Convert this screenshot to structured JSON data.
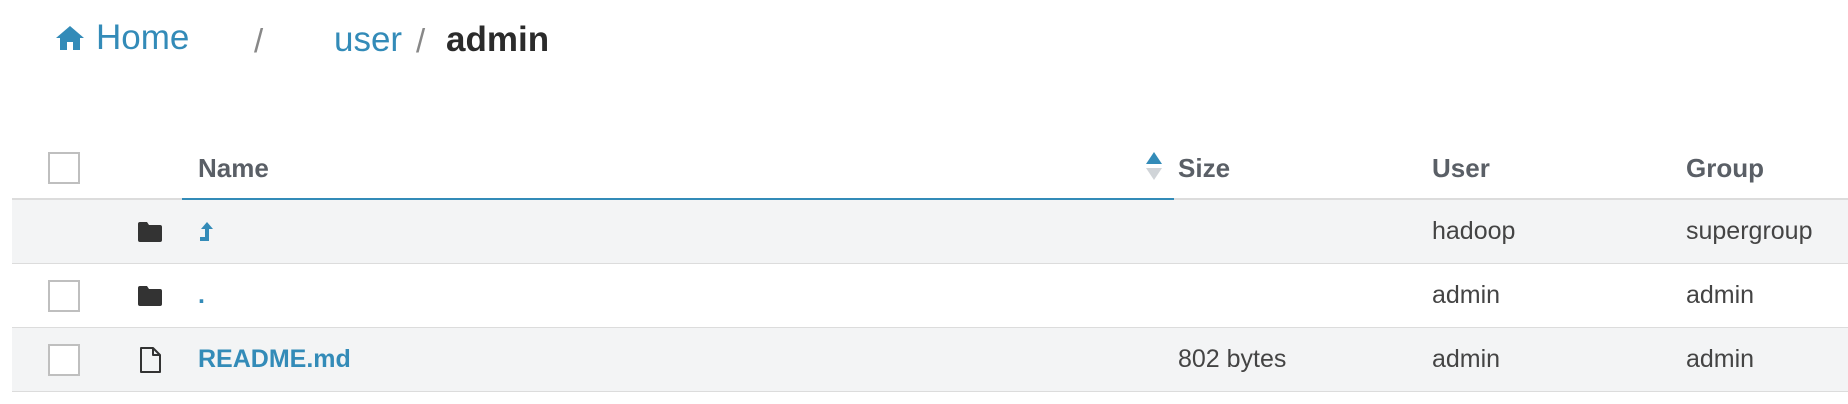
{
  "breadcrumb": {
    "home_label": "Home",
    "separator": "/",
    "user_label": "user",
    "current": "admin"
  },
  "table": {
    "columns": {
      "name": "Name",
      "size": "Size",
      "user": "User",
      "group": "Group"
    },
    "rows": [
      {
        "type": "folder",
        "name_icon": "arrow-up-icon",
        "size": "",
        "user": "hadoop",
        "group": "supergroup"
      },
      {
        "type": "folder",
        "name": ".",
        "size": "",
        "user": "admin",
        "group": "admin"
      },
      {
        "type": "file",
        "name": "README.md",
        "size": "802 bytes",
        "user": "admin",
        "group": "admin"
      }
    ]
  },
  "colors": {
    "link": "#338bb8",
    "row_alt": "#f3f4f5"
  }
}
